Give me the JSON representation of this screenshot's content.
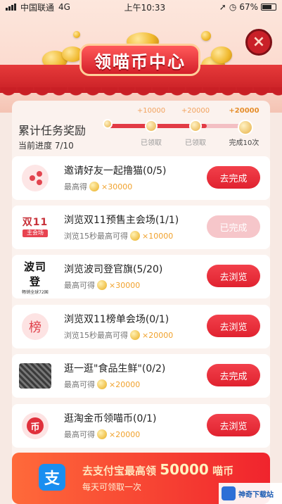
{
  "status_bar": {
    "carrier": "中国联通",
    "network": "4G",
    "time": "上午10:33",
    "battery": "67%"
  },
  "header": {
    "title": "领喵币中心",
    "close_label": "×"
  },
  "progress": {
    "title": "累计任务奖励",
    "current": "当前进度 7/10",
    "fill_fraction": 0.7,
    "milestones": [
      {
        "reward": "+10000",
        "status": "已领取"
      },
      {
        "reward": "+20000",
        "status": "已领取"
      },
      {
        "reward": "+20000",
        "status": "完成10次"
      }
    ]
  },
  "tasks": [
    {
      "title": "邀请好友一起撸猫(0/5)",
      "sub_prefix": "最高得",
      "reward": "×30000",
      "button": "去完成",
      "done": false,
      "icon": "share-icon"
    },
    {
      "title": "浏览双11预售主会场(1/1)",
      "sub_prefix": "浏览15秒最高可得",
      "reward": "×10000",
      "button": "已完成",
      "done": true,
      "icon": "double11-logo-icon"
    },
    {
      "title": "浏览波司登官旗(5/20)",
      "sub_prefix": "最高可得",
      "reward": "×30000",
      "button": "去浏览",
      "done": false,
      "icon": "bosideng-logo-icon"
    },
    {
      "title": "浏览双11榜单会场(0/1)",
      "sub_prefix": "浏览15秒最高可得",
      "reward": "×20000",
      "button": "去浏览",
      "done": false,
      "icon": "rank-icon"
    },
    {
      "title": "逛一逛\"食品生鲜\"(0/2)",
      "sub_prefix": "最高可得",
      "reward": "×20000",
      "button": "去完成",
      "done": false,
      "icon": "food-icon"
    },
    {
      "title": "逛淘金币领喵币(0/1)",
      "sub_prefix": "最高可得",
      "reward": "×20000",
      "button": "去浏览",
      "done": false,
      "icon": "taocoin-icon"
    }
  ],
  "logos": {
    "double11_top": "双11",
    "double11_tag": "主会场",
    "bosideng_name": "波司登",
    "bosideng_sub": "畅销全球72国",
    "rank_char": "榜",
    "taocoin_char": "币"
  },
  "bottom_banner": {
    "title_prefix": "去支付宝最高领",
    "title_amount": "50000",
    "title_suffix": "喵币",
    "subtitle": "每天可领取一次",
    "alipay_char": "支"
  },
  "watermark": {
    "text": "神奇下载站"
  }
}
